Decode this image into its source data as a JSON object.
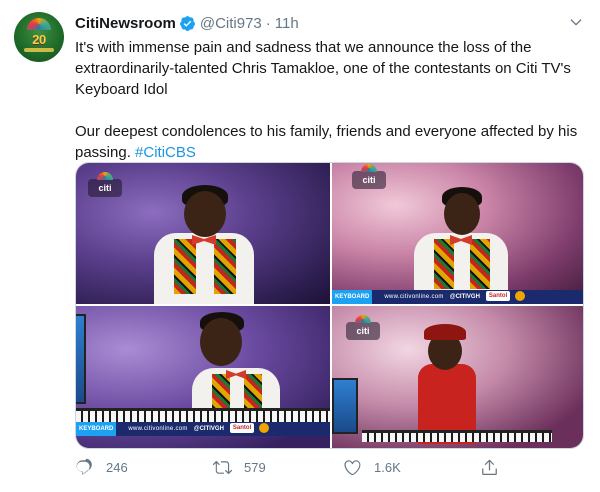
{
  "tweet": {
    "author": {
      "display_name": "CitiNewsroom",
      "handle": "@Citi973",
      "verified": true,
      "avatar_icon": "citi-anniversary-logo",
      "avatar_text": "20"
    },
    "separator": "·",
    "time": "11h",
    "body": {
      "paragraph1": "It's with immense pain and sadness that we announce the loss of the extraordinarily-talented Chris Tamakloe, one of the contestants on Citi TV's Keyboard Idol",
      "paragraph2_text": "Our deepest condolences to his family, friends and everyone affected by his passing. ",
      "hashtag": "#CitiCBS"
    },
    "media": {
      "logo_text": "citi",
      "banner_tag": "KEYBOARD",
      "banner_url": "www.citivonline.com",
      "banner_social": "@CITIVGH",
      "banner_sponsor": "Santol"
    },
    "actions": {
      "reply_count": "246",
      "retweet_count": "579",
      "like_count": "1.6K"
    },
    "colors": {
      "accent": "#1b95e0",
      "secondary_text": "#657786",
      "verified": "#1da1f2"
    }
  }
}
